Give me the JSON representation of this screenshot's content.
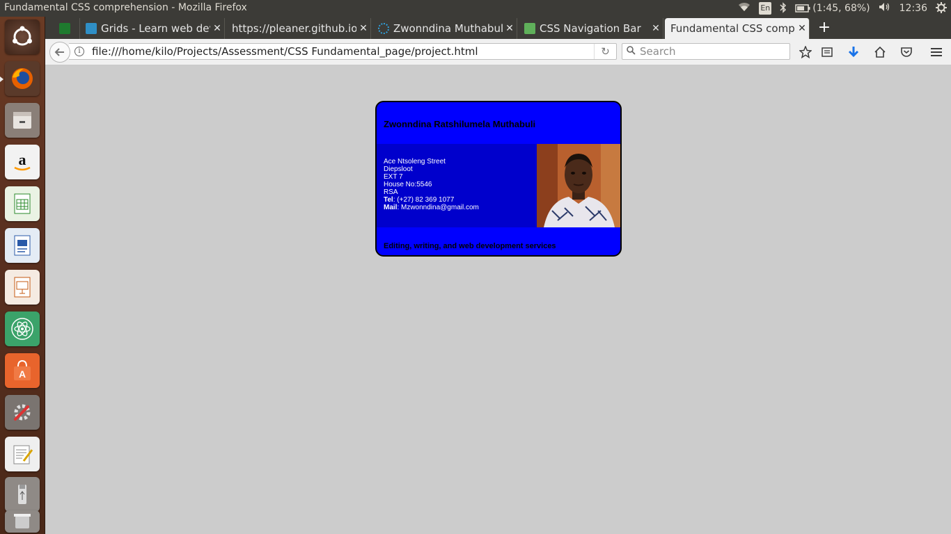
{
  "system": {
    "window_title": "Fundamental CSS comprehension - Mozilla Firefox",
    "keyboard_layout": "En",
    "battery": "(1:45, 68%)",
    "clock": "12:36"
  },
  "browser": {
    "tabs": [
      {
        "title": "",
        "icon": "android-icon",
        "icon_color": "#1e7a2e"
      },
      {
        "title": "Grids - Learn web deve",
        "icon": "mdn-icon",
        "icon_color": "#2f8fc6"
      },
      {
        "title": "https://pleaner.github.io/",
        "icon": "",
        "icon_color": ""
      },
      {
        "title": "Zwonndina Muthabuli",
        "icon": "spinner-icon",
        "icon_color": "#2fa3e0"
      },
      {
        "title": "CSS Navigation Bar",
        "icon": "codepen-icon",
        "icon_color": "#5fb05a"
      },
      {
        "title": "Fundamental CSS compre",
        "icon": "",
        "icon_color": ""
      }
    ],
    "url": "file:///home/kilo/Projects/Assessment/CSS Fundamental_page/project.html",
    "search_placeholder": "Search"
  },
  "card": {
    "name": "Zwonndina Ratshilumela Muthabuli",
    "address_lines": [
      "Ace Ntsoleng Street",
      "Diepsloot",
      "EXT 7",
      "House No:5546",
      "RSA"
    ],
    "tel_label": "Tel",
    "tel_value": ": (+27) 82 369 1077",
    "mail_label": "Mail",
    "mail_value": ": Mzwonndina@gmail.com",
    "tagline": "Editing, writing, and web development services",
    "colors": {
      "card_bg": "#0000ff",
      "middle_bg": "#0000cc"
    }
  },
  "colors": {
    "page_bg": "#cccccc",
    "panel_bg": "#3c3b37"
  }
}
